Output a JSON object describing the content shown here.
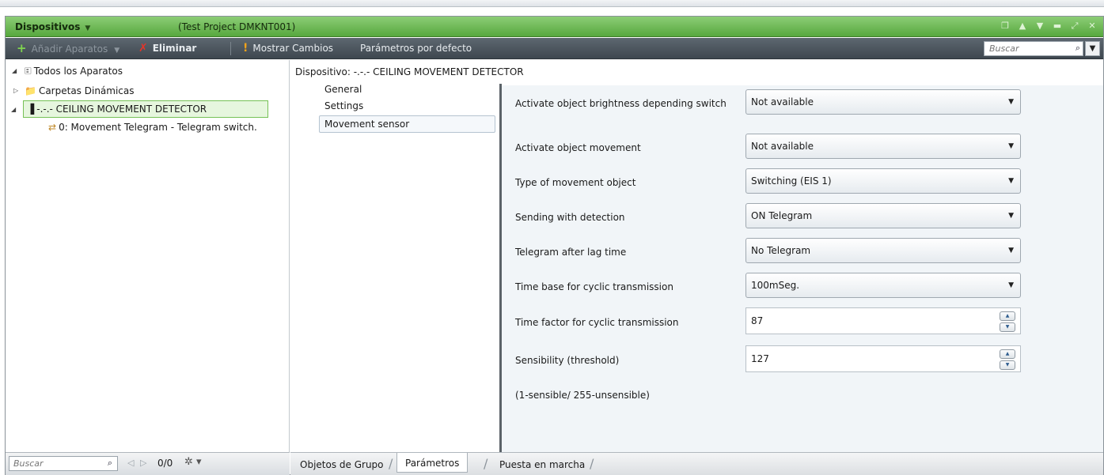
{
  "window": {
    "tab_label": "Dispositivos",
    "project": "(Test Project DMKNT001)"
  },
  "toolbar": {
    "add_label": "Añadir Aparatos",
    "delete_label": "Eliminar",
    "show_changes_label": "Mostrar Cambios",
    "defaults_label": "Parámetros por defecto",
    "search_placeholder": "Buscar"
  },
  "tree": {
    "all_devices": "Todos los Aparatos",
    "dynamic_folders": "Carpetas Dinámicas",
    "device": "-.-.- CEILING MOVEMENT DETECTOR",
    "object": "0: Movement Telegram - Telegram switch."
  },
  "tree_footer": {
    "search_placeholder": "Buscar",
    "count": "0/0"
  },
  "device_header": "Dispositivo: -.-.-  CEILING MOVEMENT DETECTOR",
  "categories": [
    "General",
    "Settings",
    "Movement sensor"
  ],
  "parameters": [
    {
      "label": "Activate object brightness depending switch",
      "value": "Not available"
    },
    {
      "label": "Activate object movement",
      "value": "Not available"
    },
    {
      "label": "Type of movement object",
      "value": "Switching (EIS 1)"
    },
    {
      "label": "Sending with detection",
      "value": "ON Telegram"
    },
    {
      "label": "Telegram after lag time",
      "value": "No Telegram"
    },
    {
      "label": "Time base for cyclic transmission",
      "value": "100mSeg."
    },
    {
      "label": "Time factor for cyclic transmission",
      "value": "87"
    },
    {
      "label": "Sensibility (threshold)",
      "value": "127"
    }
  ],
  "note": "(1-sensible/ 255-unsensible)",
  "bottom_tabs": [
    "Objetos de Grupo",
    "Parámetros",
    "Puesta en marcha"
  ],
  "colors": {
    "accent_green": "#57a83e",
    "toolbar_dark": "#3e474f",
    "param_bg": "#f1f5f8"
  }
}
